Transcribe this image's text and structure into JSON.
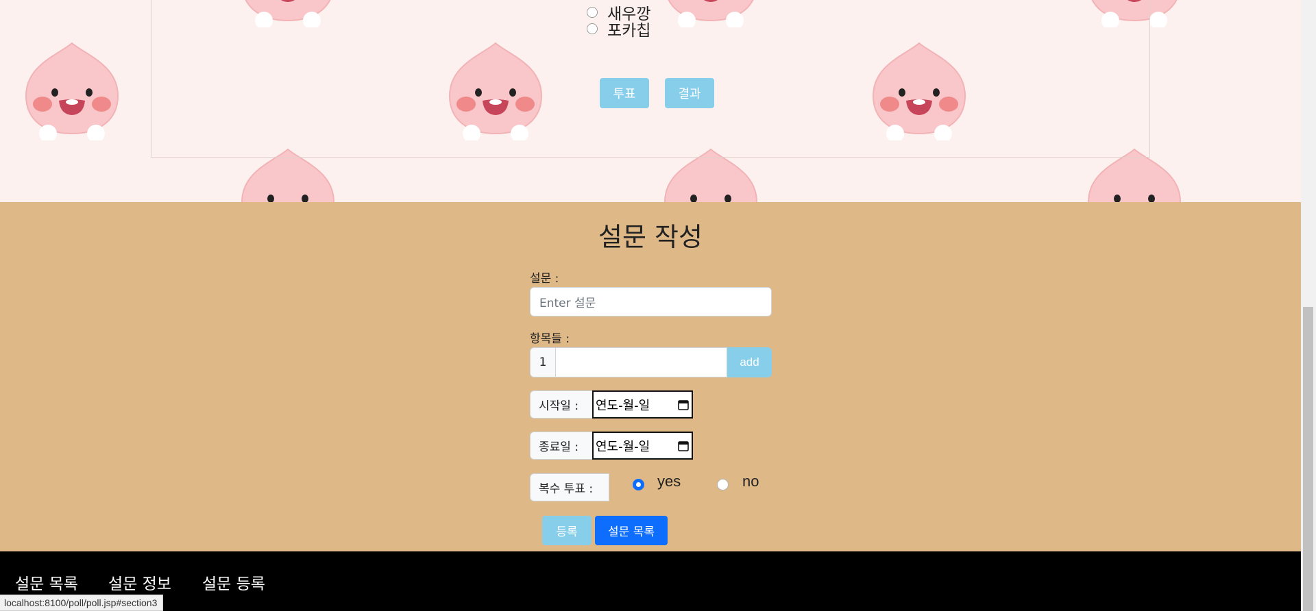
{
  "poll": {
    "options": [
      "새우깡",
      "포카칩"
    ],
    "vote_label": "투표",
    "result_label": "결과"
  },
  "form": {
    "title": "설문 작성",
    "question_label": "설문 :",
    "question_placeholder": "Enter 설문",
    "items_label": "항목들 :",
    "item_index": "1",
    "item_value": "",
    "add_label": "add",
    "start_label": "시작일 :",
    "start_value": "연도-월-일",
    "end_label": "종료일 :",
    "end_value": "연도-월-일",
    "multi_label": "복수 투표 :",
    "yes_label": "yes",
    "no_label": "no",
    "multi_selected": "yes",
    "register_label": "등록",
    "list_label": "설문 목록"
  },
  "footer": {
    "nav": [
      "설문 목록",
      "설문 정보",
      "설문 등록"
    ]
  },
  "status_url": "localhost:8100/poll/poll.jsp#section3",
  "colors": {
    "top_bg": "#fdf1ef",
    "form_bg": "#deb887",
    "sky_button": "#87ceeb",
    "primary_button": "#0d6efd",
    "footer_bg": "#000000"
  }
}
